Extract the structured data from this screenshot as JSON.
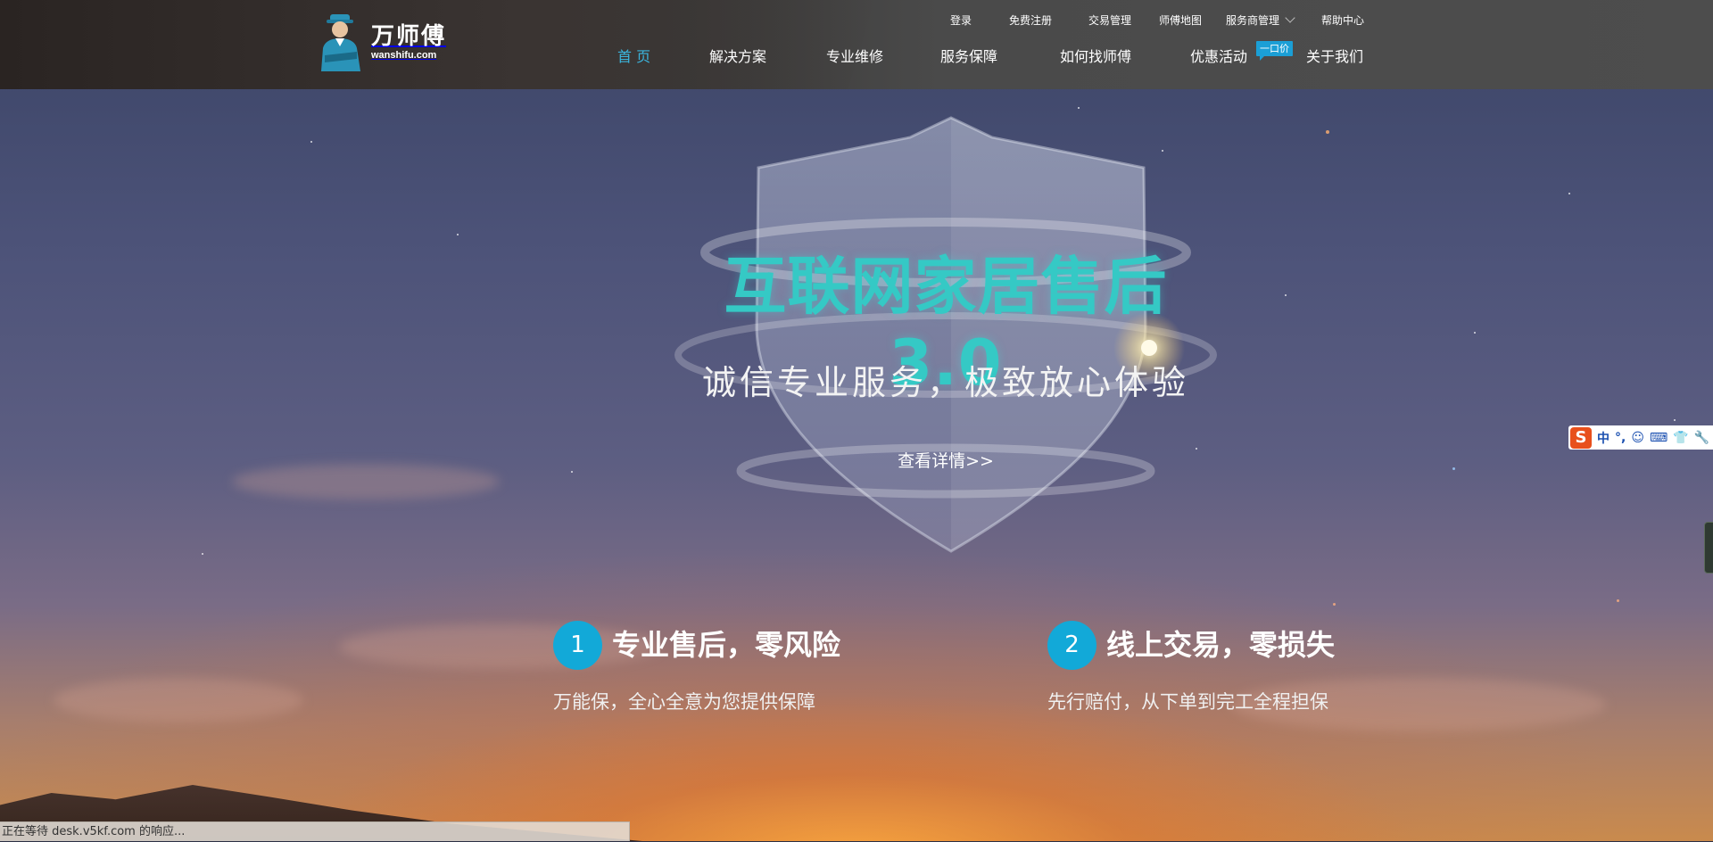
{
  "brand": {
    "name": "万师傅",
    "domain": "wanshifu.com"
  },
  "top_nav": {
    "login": "登录",
    "register": "免费注册",
    "trade": "交易管理",
    "map": "师傅地图",
    "provider": "服务商管理",
    "help": "帮助中心"
  },
  "main_nav": {
    "home": "首 页",
    "solutions": "解决方案",
    "repair": "专业维修",
    "guarantee": "服务保障",
    "find_master": "如何找师傅",
    "promotions": "优惠活动",
    "promo_badge": "一口价",
    "about": "关于我们"
  },
  "hero": {
    "headline": "互联网家居售后3.0",
    "subline": "诚信专业服务，极致放心体验",
    "detail_link": "查看详情>>"
  },
  "features": [
    {
      "number": "1",
      "title": "专业售后，零风险",
      "desc": "万能保，全心全意为您提供保障"
    },
    {
      "number": "2",
      "title": "线上交易，零损失",
      "desc": "先行赔付，从下单到完工全程担保"
    }
  ],
  "ime_toolbar": {
    "logo": "S",
    "mode": "中",
    "punct": "°,"
  },
  "status_bar": {
    "text": "正在等待 desk.v5kf.com 的响应..."
  },
  "colors": {
    "accent": "#3bb6df",
    "headline": "#35c9c5",
    "badge": "#1b9fd6",
    "number_circle": "#12a9d8"
  }
}
